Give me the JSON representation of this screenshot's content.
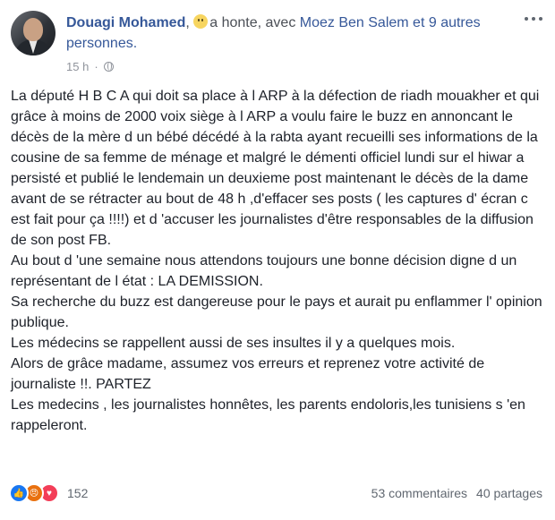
{
  "header": {
    "author": "Douagi Mohamed",
    "separator": ", ",
    "feeling": "a honte",
    "with_prefix": ", avec ",
    "tagged_person": "Moez Ben Salem",
    "and_others": " et 9 autres personnes.",
    "timestamp": "15 h",
    "audience_icon": "globe-icon"
  },
  "post": {
    "paragraphs": [
      "La député H B C A qui doit sa place à l ARP à la défection de riadh mouakher et qui grâce à moins de 2000 voix siège à l ARP a voulu faire le buzz en annoncant le décès de la mère d un bébé décédé à la rabta ayant recueilli ses informations de la cousine de sa femme de ménage et malgré le démenti officiel lundi sur el hiwar a persisté et publié le lendemain un deuxieme post maintenant le décès de la dame avant de se rétracter au bout de 48 h ,d'effacer ses posts ( les captures d' écran c est fait pour ça !!!!) et d 'accuser les journalistes d'être responsables de la diffusion de son post FB.",
      "Au bout d 'une semaine nous attendons toujours une bonne décision digne d un représentant de l état : LA DEMISSION.",
      "Sa recherche du buzz est dangereuse pour le pays et aurait pu enflammer l' opinion publique.",
      "Les médecins se rappellent aussi de ses insultes il y a quelques mois.",
      "Alors de grâce madame, assumez vos erreurs et reprenez votre activité de journaliste !!. PARTEZ",
      "Les medecins , les journalistes honnêtes, les parents endoloris,les tunisiens s 'en rappeleront."
    ]
  },
  "footer": {
    "reaction_icons": [
      "like-icon",
      "angry-icon",
      "love-icon"
    ],
    "reaction_count": "152",
    "comments": "53 commentaires",
    "shares": "40 partages"
  },
  "colors": {
    "link": "#365899",
    "text": "#1d2129",
    "meta": "#90949c",
    "like": "#1877f2",
    "angry": "#e9710f",
    "love": "#f33e58"
  }
}
